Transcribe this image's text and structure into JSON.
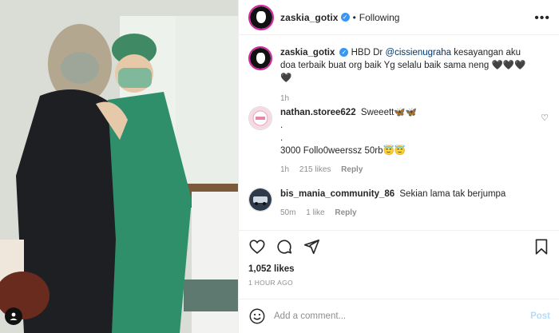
{
  "post": {
    "author": "zaskia_gotix",
    "follow_status": "Following",
    "dot": "•",
    "verified_mark": "✓"
  },
  "caption": {
    "username": "zaskia_gotix",
    "text_prefix": "HBD Dr",
    "mention": "@cissienugraha",
    "text_suffix": "kesayangan aku doa terbaik buat org baik Yg selalu baik sama neng 🖤🖤🖤🖤",
    "time": "1h"
  },
  "comments": [
    {
      "username": "nathan.storee622",
      "line1": "Sweeett🦋🦋",
      "line2": ".",
      "line3": ".",
      "line4": "3000 Follo0weerssz 50rb😇😇",
      "time": "1h",
      "likes": "215 likes",
      "reply": "Reply"
    },
    {
      "username": "bis_mania_community_86",
      "text": "Sekian lama tak berjumpa",
      "time": "50m",
      "likes": "1 like",
      "reply": "Reply"
    }
  ],
  "stats": {
    "likes": "1,052 likes",
    "time_ago": "1 HOUR AGO"
  },
  "comment_box": {
    "placeholder": "Add a comment...",
    "post_label": "Post"
  },
  "icons": {
    "more": "•••",
    "heart": "♡"
  },
  "colors": {
    "verified": "#3897f0",
    "mention": "#00376b",
    "post_disabled": "#b3dbff",
    "story_ring": "#d6249f"
  }
}
